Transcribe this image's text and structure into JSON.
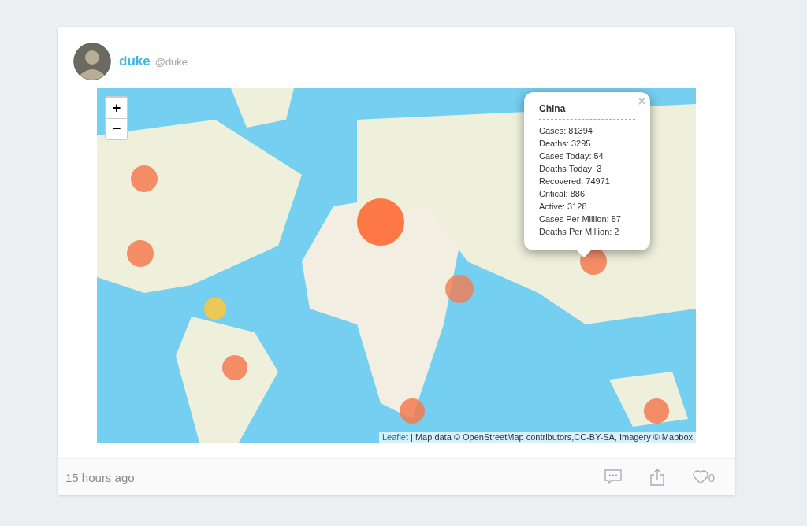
{
  "post": {
    "author": "duke",
    "handle": "@duke",
    "time": "15 hours ago",
    "likes": "0"
  },
  "map": {
    "kind": "picture",
    "zoom_in": "+",
    "zoom_out": "−",
    "popup": {
      "title": "China",
      "close": "×",
      "lines": [
        "Cases: 81394",
        "Deaths: 3295",
        "Cases Today: 54",
        "Deaths Today: 3",
        "Recovered: 74971",
        "Critical: 886",
        "Active: 3128",
        "Cases Per Million: 57",
        "Deaths Per Million: 2"
      ]
    },
    "attribution": {
      "link": "Leaflet",
      "text": "| Map data © OpenStreetMap contributors,CC-BY-SA, Imagery © Mapbox"
    }
  }
}
